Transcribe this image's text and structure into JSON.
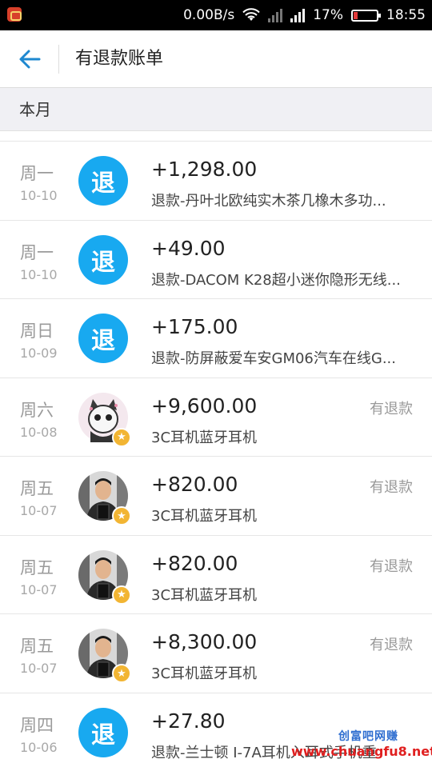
{
  "status_bar": {
    "network_speed": "0.00B/s",
    "battery_percent": "17%",
    "time": "18:55",
    "battery_level": 0.17,
    "battery_color": "#e23b3b"
  },
  "header": {
    "title": "有退款账单",
    "back_icon": "arrow-left-icon",
    "accent_color": "#1e88d0"
  },
  "section": {
    "label": "本月"
  },
  "transactions": [
    {
      "day": "周一",
      "date": "10-10",
      "avatar": "退",
      "avatar_type": "refund",
      "amount": "+1,298.00",
      "desc": "退款-丹叶北欧纯实木茶几橡木多功...",
      "status": ""
    },
    {
      "day": "周一",
      "date": "10-10",
      "avatar": "退",
      "avatar_type": "refund",
      "amount": "+49.00",
      "desc": "退款-DACOM K28超小迷你隐形无线...",
      "status": ""
    },
    {
      "day": "周日",
      "date": "10-09",
      "avatar": "退",
      "avatar_type": "refund",
      "amount": "+175.00",
      "desc": "退款-防屏蔽爱车安GM06汽车在线G...",
      "status": ""
    },
    {
      "day": "周六",
      "date": "10-08",
      "avatar": "",
      "avatar_type": "cartoon",
      "amount": "+9,600.00",
      "desc": "3C耳机蓝牙耳机",
      "status": "有退款"
    },
    {
      "day": "周五",
      "date": "10-07",
      "avatar": "",
      "avatar_type": "photo",
      "amount": "+820.00",
      "desc": "3C耳机蓝牙耳机",
      "status": "有退款"
    },
    {
      "day": "周五",
      "date": "10-07",
      "avatar": "",
      "avatar_type": "photo",
      "amount": "+820.00",
      "desc": "3C耳机蓝牙耳机",
      "status": "有退款"
    },
    {
      "day": "周五",
      "date": "10-07",
      "avatar": "",
      "avatar_type": "photo",
      "amount": "+8,300.00",
      "desc": "3C耳机蓝牙耳机",
      "status": "有退款"
    },
    {
      "day": "周四",
      "date": "10-06",
      "avatar": "退",
      "avatar_type": "refund",
      "amount": "+27.80",
      "desc": "退款-兰士顿 I-7A耳机入耳式手机重",
      "status": ""
    }
  ],
  "watermark": {
    "line1": "创富吧网赚",
    "line2": "www.chuangfu8.net"
  },
  "colors": {
    "refund_badge": "#18a9f0",
    "star_badge": "#f2b533",
    "section_bg": "#f0f0f4"
  }
}
